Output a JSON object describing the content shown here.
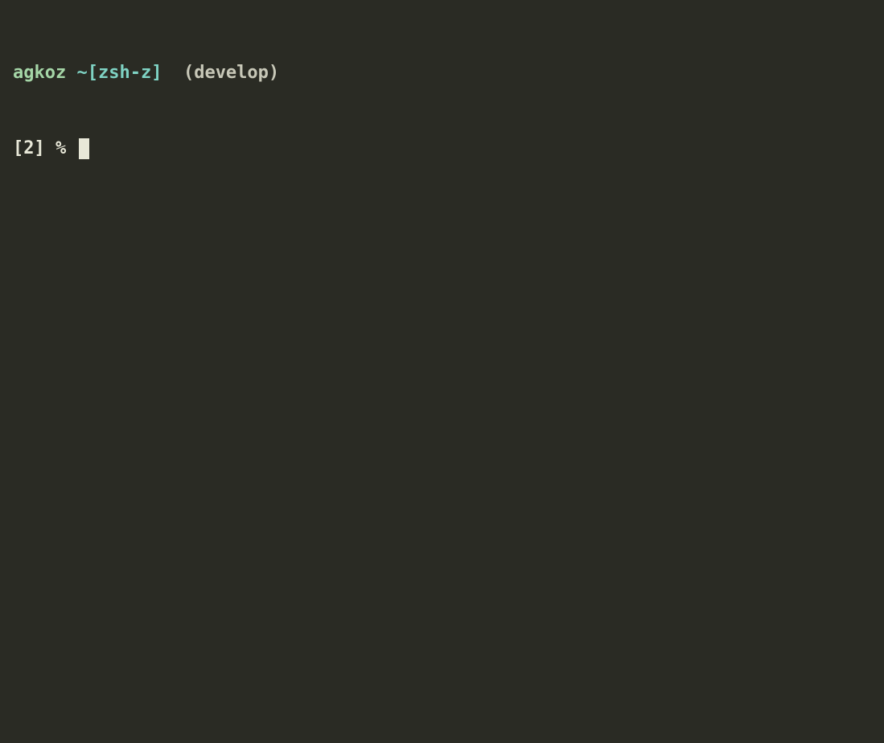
{
  "prompt": {
    "line1": {
      "user": "agkoz",
      "path": "~[zsh-z]",
      "branch": "(develop)"
    },
    "line2": {
      "jobs": "[2]",
      "symbol": "%",
      "ghost_suggestion": ""
    }
  }
}
